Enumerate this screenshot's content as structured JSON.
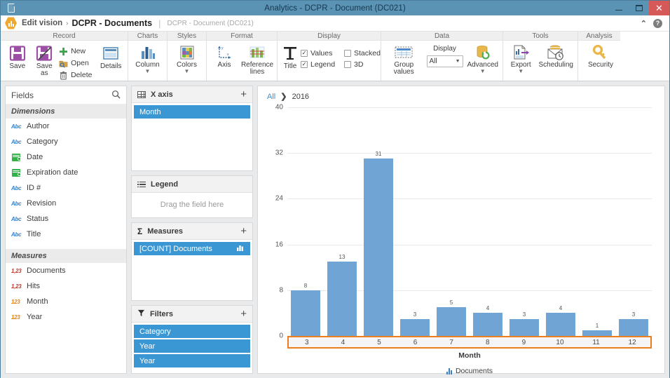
{
  "window": {
    "title": "Analytics - DCPR - Document (DC021)",
    "app_icon": "document-icon",
    "minimize_label": "Minimize",
    "maximize_label": "Maximize",
    "close_label": "✕"
  },
  "breadcrumb": {
    "logo": "analytics-hex-logo",
    "edit": "Edit vision",
    "separator": "›",
    "current": "DCPR - Documents",
    "divider": "|",
    "subtitle": "DCPR - Document (DC021)",
    "collapse_icon": "chevron-up-icon",
    "help_icon": "help-icon",
    "help_glyph": "?"
  },
  "ribbon": {
    "groups": [
      {
        "title": "Record",
        "buttons": [
          {
            "label": "Save",
            "icon": "save-icon"
          },
          {
            "label": "Save as",
            "icon": "save-as-icon"
          },
          {
            "label": "New",
            "icon": "plus-icon"
          },
          {
            "label": "Open",
            "icon": "folder-open-icon"
          },
          {
            "label": "Delete",
            "icon": "trash-icon"
          },
          {
            "label": "Details",
            "icon": "details-window-icon"
          }
        ]
      },
      {
        "title": "Charts",
        "buttons": [
          {
            "label": "Column",
            "icon": "column-chart-icon",
            "has_caret": true
          }
        ]
      },
      {
        "title": "Styles",
        "buttons": [
          {
            "label": "Colors",
            "icon": "color-palette-icon",
            "has_caret": true
          }
        ]
      },
      {
        "title": "Format",
        "buttons": [
          {
            "label": "Axis",
            "icon": "axis-icon"
          },
          {
            "label": "Reference",
            "label2": "lines",
            "icon": "reference-lines-icon"
          }
        ]
      },
      {
        "title": "Display",
        "buttons": [
          {
            "label": "Title",
            "icon": "title-T-icon"
          }
        ],
        "checkboxes": [
          {
            "label": "Values",
            "checked": true
          },
          {
            "label": "Stacked",
            "checked": false
          },
          {
            "label": "Legend",
            "checked": true
          },
          {
            "label": "3D",
            "checked": false
          }
        ]
      },
      {
        "title": "Data",
        "buttons": [
          {
            "label": "Group values",
            "icon": "group-values-icon"
          },
          {
            "label": "Advanced",
            "icon": "database-refresh-icon",
            "has_caret": true
          }
        ],
        "select": {
          "caption": "Display",
          "value": "All",
          "arrow": "▼"
        }
      },
      {
        "title": "Tools",
        "buttons": [
          {
            "label": "Export",
            "icon": "export-icon",
            "has_caret": true
          },
          {
            "label": "Scheduling",
            "icon": "scheduling-mail-clock-icon"
          }
        ]
      },
      {
        "title": "Analysis",
        "buttons": [
          {
            "label": "Security",
            "icon": "key-icon"
          }
        ]
      }
    ]
  },
  "fields_panel": {
    "title": "Fields",
    "search_icon": "search-icon",
    "sections": [
      {
        "title": "Dimensions",
        "items": [
          {
            "label": "Author",
            "icon": "abc-text-icon",
            "type": "abc"
          },
          {
            "label": "Category",
            "icon": "abc-text-icon",
            "type": "abc"
          },
          {
            "label": "Date",
            "icon": "calendar-icon",
            "type": "cal"
          },
          {
            "label": "Expiration date",
            "icon": "calendar-icon",
            "type": "cal"
          },
          {
            "label": "ID #",
            "icon": "abc-text-icon",
            "type": "abc"
          },
          {
            "label": "Revision",
            "icon": "abc-text-icon",
            "type": "abc"
          },
          {
            "label": "Status",
            "icon": "abc-text-icon",
            "type": "abc"
          },
          {
            "label": "Title",
            "icon": "abc-text-icon",
            "type": "abc"
          }
        ]
      },
      {
        "title": "Measures",
        "items": [
          {
            "label": "Documents",
            "icon": "decimal-number-icon",
            "type": "num-red",
            "glyph": "1,23"
          },
          {
            "label": "Hits",
            "icon": "decimal-number-icon",
            "type": "num-red",
            "glyph": "1,23"
          },
          {
            "label": "Month",
            "icon": "integer-number-icon",
            "type": "num-org",
            "glyph": "123"
          },
          {
            "label": "Year",
            "icon": "integer-number-icon",
            "type": "num-org",
            "glyph": "123"
          }
        ]
      }
    ]
  },
  "shelves": [
    {
      "key": "xaxis",
      "title": "X axis",
      "icon": "grid-icon",
      "add_label": "+",
      "pills": [
        {
          "label": "Month"
        }
      ]
    },
    {
      "key": "legend",
      "title": "Legend",
      "icon": "list-icon",
      "add_label": "",
      "placeholder": "Drag the field here",
      "pills": []
    },
    {
      "key": "measures",
      "title": "Measures",
      "icon": "sigma-icon",
      "add_label": "+",
      "pills": [
        {
          "label": "[COUNT] Documents",
          "trailing_icon": "bar-chart-icon"
        }
      ]
    },
    {
      "key": "filters",
      "title": "Filters",
      "icon": "funnel-icon",
      "add_label": "+",
      "pills": [
        {
          "label": "Category"
        },
        {
          "label": "Year"
        },
        {
          "label": "Year"
        }
      ]
    }
  ],
  "chart_crumb": {
    "all": "All",
    "arrow": "❯",
    "year": "2016"
  },
  "colors": {
    "bar": "#6fa4d4",
    "accent_blue": "#3b97d3",
    "highlight_orange": "#ec7e1e",
    "titlebar": "#5b93b5",
    "close_red": "#d6595a"
  },
  "chart_data": {
    "type": "bar",
    "title": "",
    "categories": [
      "3",
      "4",
      "5",
      "6",
      "7",
      "8",
      "9",
      "10",
      "11",
      "12"
    ],
    "values": [
      8,
      13,
      31,
      3,
      5,
      4,
      3,
      4,
      1,
      3
    ],
    "series": [
      {
        "name": "Documents",
        "values": [
          8,
          13,
          31,
          3,
          5,
          4,
          3,
          4,
          1,
          3
        ]
      }
    ],
    "xlabel": "Month",
    "ylabel": "",
    "ylim": [
      0,
      40
    ],
    "yticks": [
      40,
      32,
      24,
      16,
      8,
      0
    ],
    "grid": true,
    "legend": [
      "Documents"
    ],
    "legend_position": "bottom",
    "breadcrumb": "All > 2016"
  }
}
